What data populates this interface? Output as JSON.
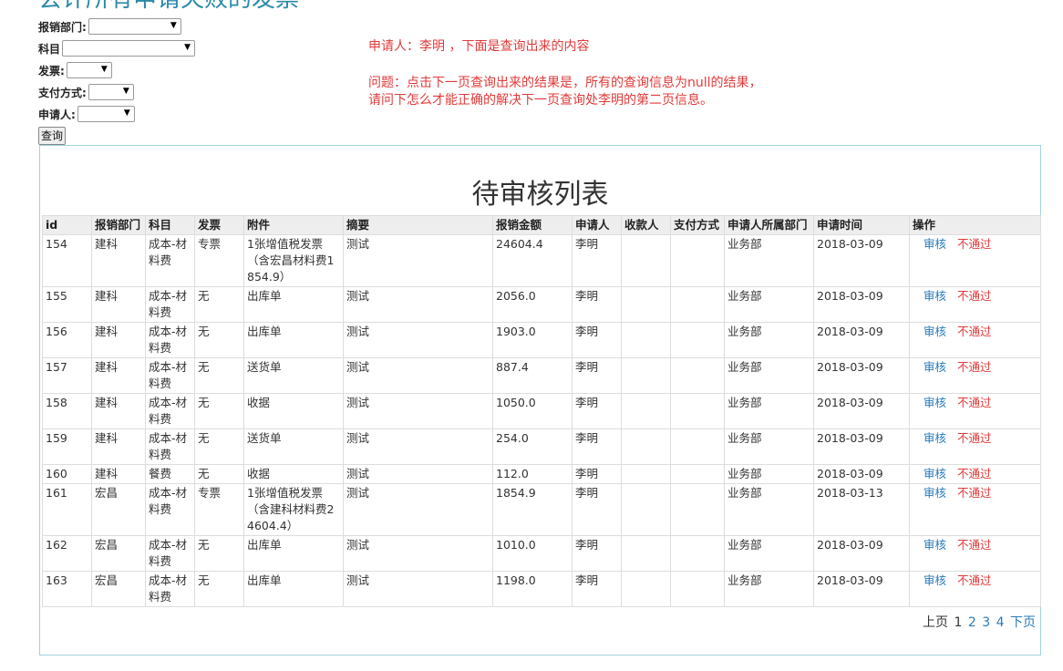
{
  "page": {
    "heading": "会计所有申请失败的发票"
  },
  "filters": [
    {
      "label": "报销部门:",
      "value": ""
    },
    {
      "label": "科目",
      "value": ""
    },
    {
      "label": "发票:",
      "value": ""
    },
    {
      "label": "支付方式:",
      "value": ""
    },
    {
      "label": "申请人:",
      "value": ""
    }
  ],
  "query_button": "查询",
  "notes": {
    "line1": "申请人：李明 ，下面是查询出来的内容",
    "line2": "问题：点击下一页查询出来的结果是，所有的查询信息为null的结果，",
    "line3": "请问下怎么才能正确的解决下一页查询处李明的第二页信息。"
  },
  "table": {
    "title": "待审核列表",
    "columns": [
      "id",
      "报销部门",
      "科目",
      "发票",
      "附件",
      "摘要",
      "报销金额",
      "申请人",
      "收款人",
      "支付方式",
      "申请人所属部门",
      "申请时间",
      "操作"
    ],
    "approve_label": "审核",
    "reject_label": "不通过",
    "rows": [
      {
        "id": "154",
        "dept": "建科",
        "subject": "成本-材料费",
        "invoice": "专票",
        "attachment": "1张增值税发票（含宏昌材料费1854.9）",
        "summary": "测试",
        "amount": "24604.4",
        "applicant": "李明",
        "payee": "",
        "payment": "",
        "applicant_dept": "业务部",
        "date": "2018-03-09"
      },
      {
        "id": "155",
        "dept": "建科",
        "subject": "成本-材料费",
        "invoice": "无",
        "attachment": "出库单",
        "summary": "测试",
        "amount": "2056.0",
        "applicant": "李明",
        "payee": "",
        "payment": "",
        "applicant_dept": "业务部",
        "date": "2018-03-09"
      },
      {
        "id": "156",
        "dept": "建科",
        "subject": "成本-材料费",
        "invoice": "无",
        "attachment": "出库单",
        "summary": "测试",
        "amount": "1903.0",
        "applicant": "李明",
        "payee": "",
        "payment": "",
        "applicant_dept": "业务部",
        "date": "2018-03-09"
      },
      {
        "id": "157",
        "dept": "建科",
        "subject": "成本-材料费",
        "invoice": "无",
        "attachment": "送货单",
        "summary": "测试",
        "amount": "887.4",
        "applicant": "李明",
        "payee": "",
        "payment": "",
        "applicant_dept": "业务部",
        "date": "2018-03-09"
      },
      {
        "id": "158",
        "dept": "建科",
        "subject": "成本-材料费",
        "invoice": "无",
        "attachment": "收据",
        "summary": "测试",
        "amount": "1050.0",
        "applicant": "李明",
        "payee": "",
        "payment": "",
        "applicant_dept": "业务部",
        "date": "2018-03-09"
      },
      {
        "id": "159",
        "dept": "建科",
        "subject": "成本-材料费",
        "invoice": "无",
        "attachment": "送货单",
        "summary": "测试",
        "amount": "254.0",
        "applicant": "李明",
        "payee": "",
        "payment": "",
        "applicant_dept": "业务部",
        "date": "2018-03-09"
      },
      {
        "id": "160",
        "dept": "建科",
        "subject": "餐费",
        "invoice": "无",
        "attachment": "收据",
        "summary": "测试",
        "amount": "112.0",
        "applicant": "李明",
        "payee": "",
        "payment": "",
        "applicant_dept": "业务部",
        "date": "2018-03-09"
      },
      {
        "id": "161",
        "dept": "宏昌",
        "subject": "成本-材料费",
        "invoice": "专票",
        "attachment": "1张增值税发票（含建科材料费24604.4）",
        "summary": "测试",
        "amount": "1854.9",
        "applicant": "李明",
        "payee": "",
        "payment": "",
        "applicant_dept": "业务部",
        "date": "2018-03-13"
      },
      {
        "id": "162",
        "dept": "宏昌",
        "subject": "成本-材料费",
        "invoice": "无",
        "attachment": "出库单",
        "summary": "测试",
        "amount": "1010.0",
        "applicant": "李明",
        "payee": "",
        "payment": "",
        "applicant_dept": "业务部",
        "date": "2018-03-09"
      },
      {
        "id": "163",
        "dept": "宏昌",
        "subject": "成本-材料费",
        "invoice": "无",
        "attachment": "出库单",
        "summary": "测试",
        "amount": "1198.0",
        "applicant": "李明",
        "payee": "",
        "payment": "",
        "applicant_dept": "业务部",
        "date": "2018-03-09"
      }
    ]
  },
  "pagination": {
    "prev": "上页",
    "pages": [
      "1",
      "2",
      "3",
      "4"
    ],
    "current": "1",
    "next": "下页"
  }
}
